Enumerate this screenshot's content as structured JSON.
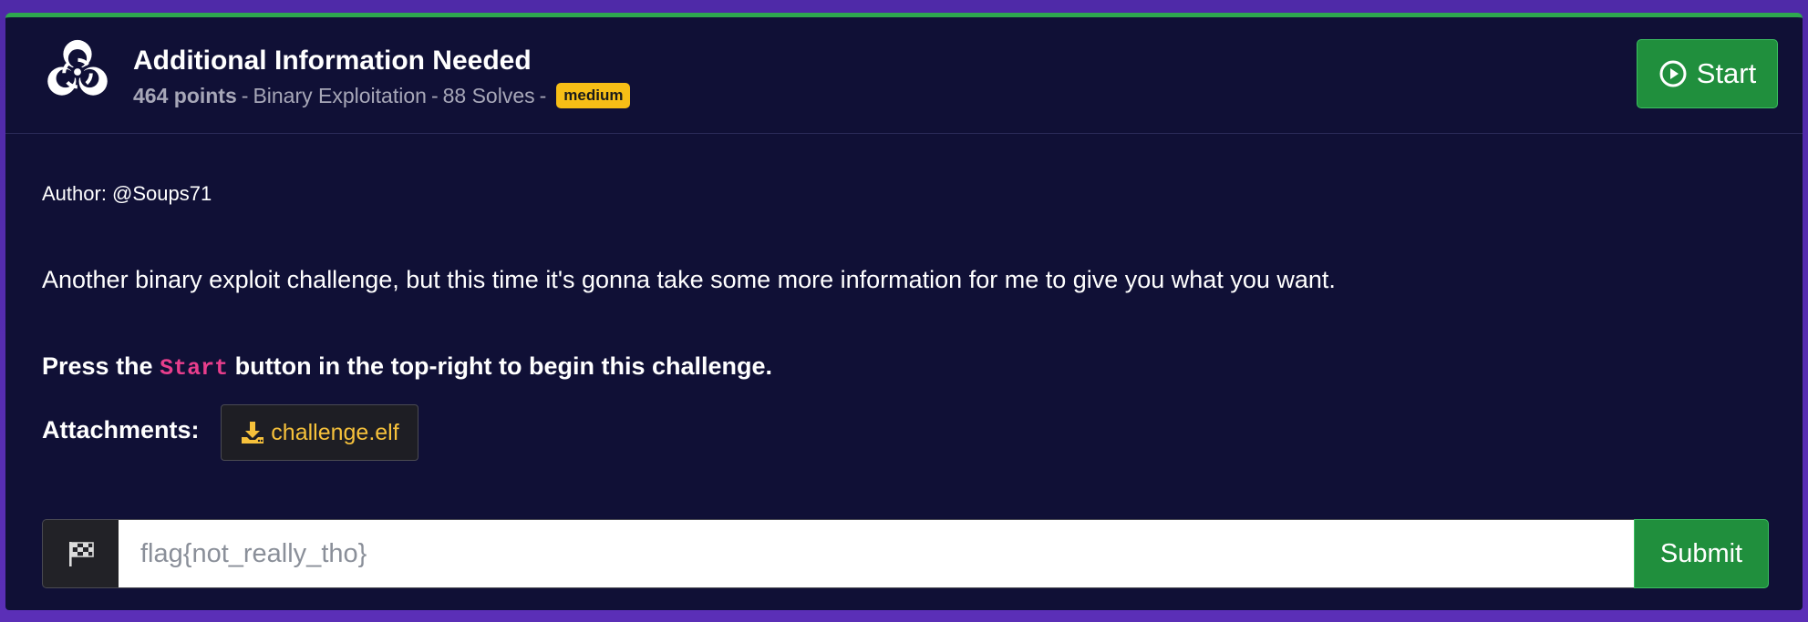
{
  "challenge": {
    "title": "Additional Information Needed",
    "points": "464 points",
    "separator": "-",
    "category": "Binary Exploitation",
    "solves": "88 Solves",
    "difficulty": "medium",
    "icon": "biohazard-icon"
  },
  "header": {
    "start_label": "Start"
  },
  "body": {
    "author": "Author: @Soups71",
    "description": "Another binary exploit challenge, but this time it's gonna take some more information for me to give you what you want.",
    "press_prefix": "Press the",
    "press_code": "Start",
    "press_suffix": "button in the top-right to begin this challenge.",
    "attachments_label": "Attachments:",
    "attachment_file": "challenge.elf"
  },
  "flag_form": {
    "placeholder": "flag{not_really_tho}",
    "submit_label": "Submit"
  },
  "colors": {
    "background": "#5b2fb7",
    "card": "#101036",
    "accent_green": "#208f3d",
    "badge_yellow": "#f7be16",
    "code_pink": "#e83e8c",
    "attachment_text": "#f6c13b"
  }
}
